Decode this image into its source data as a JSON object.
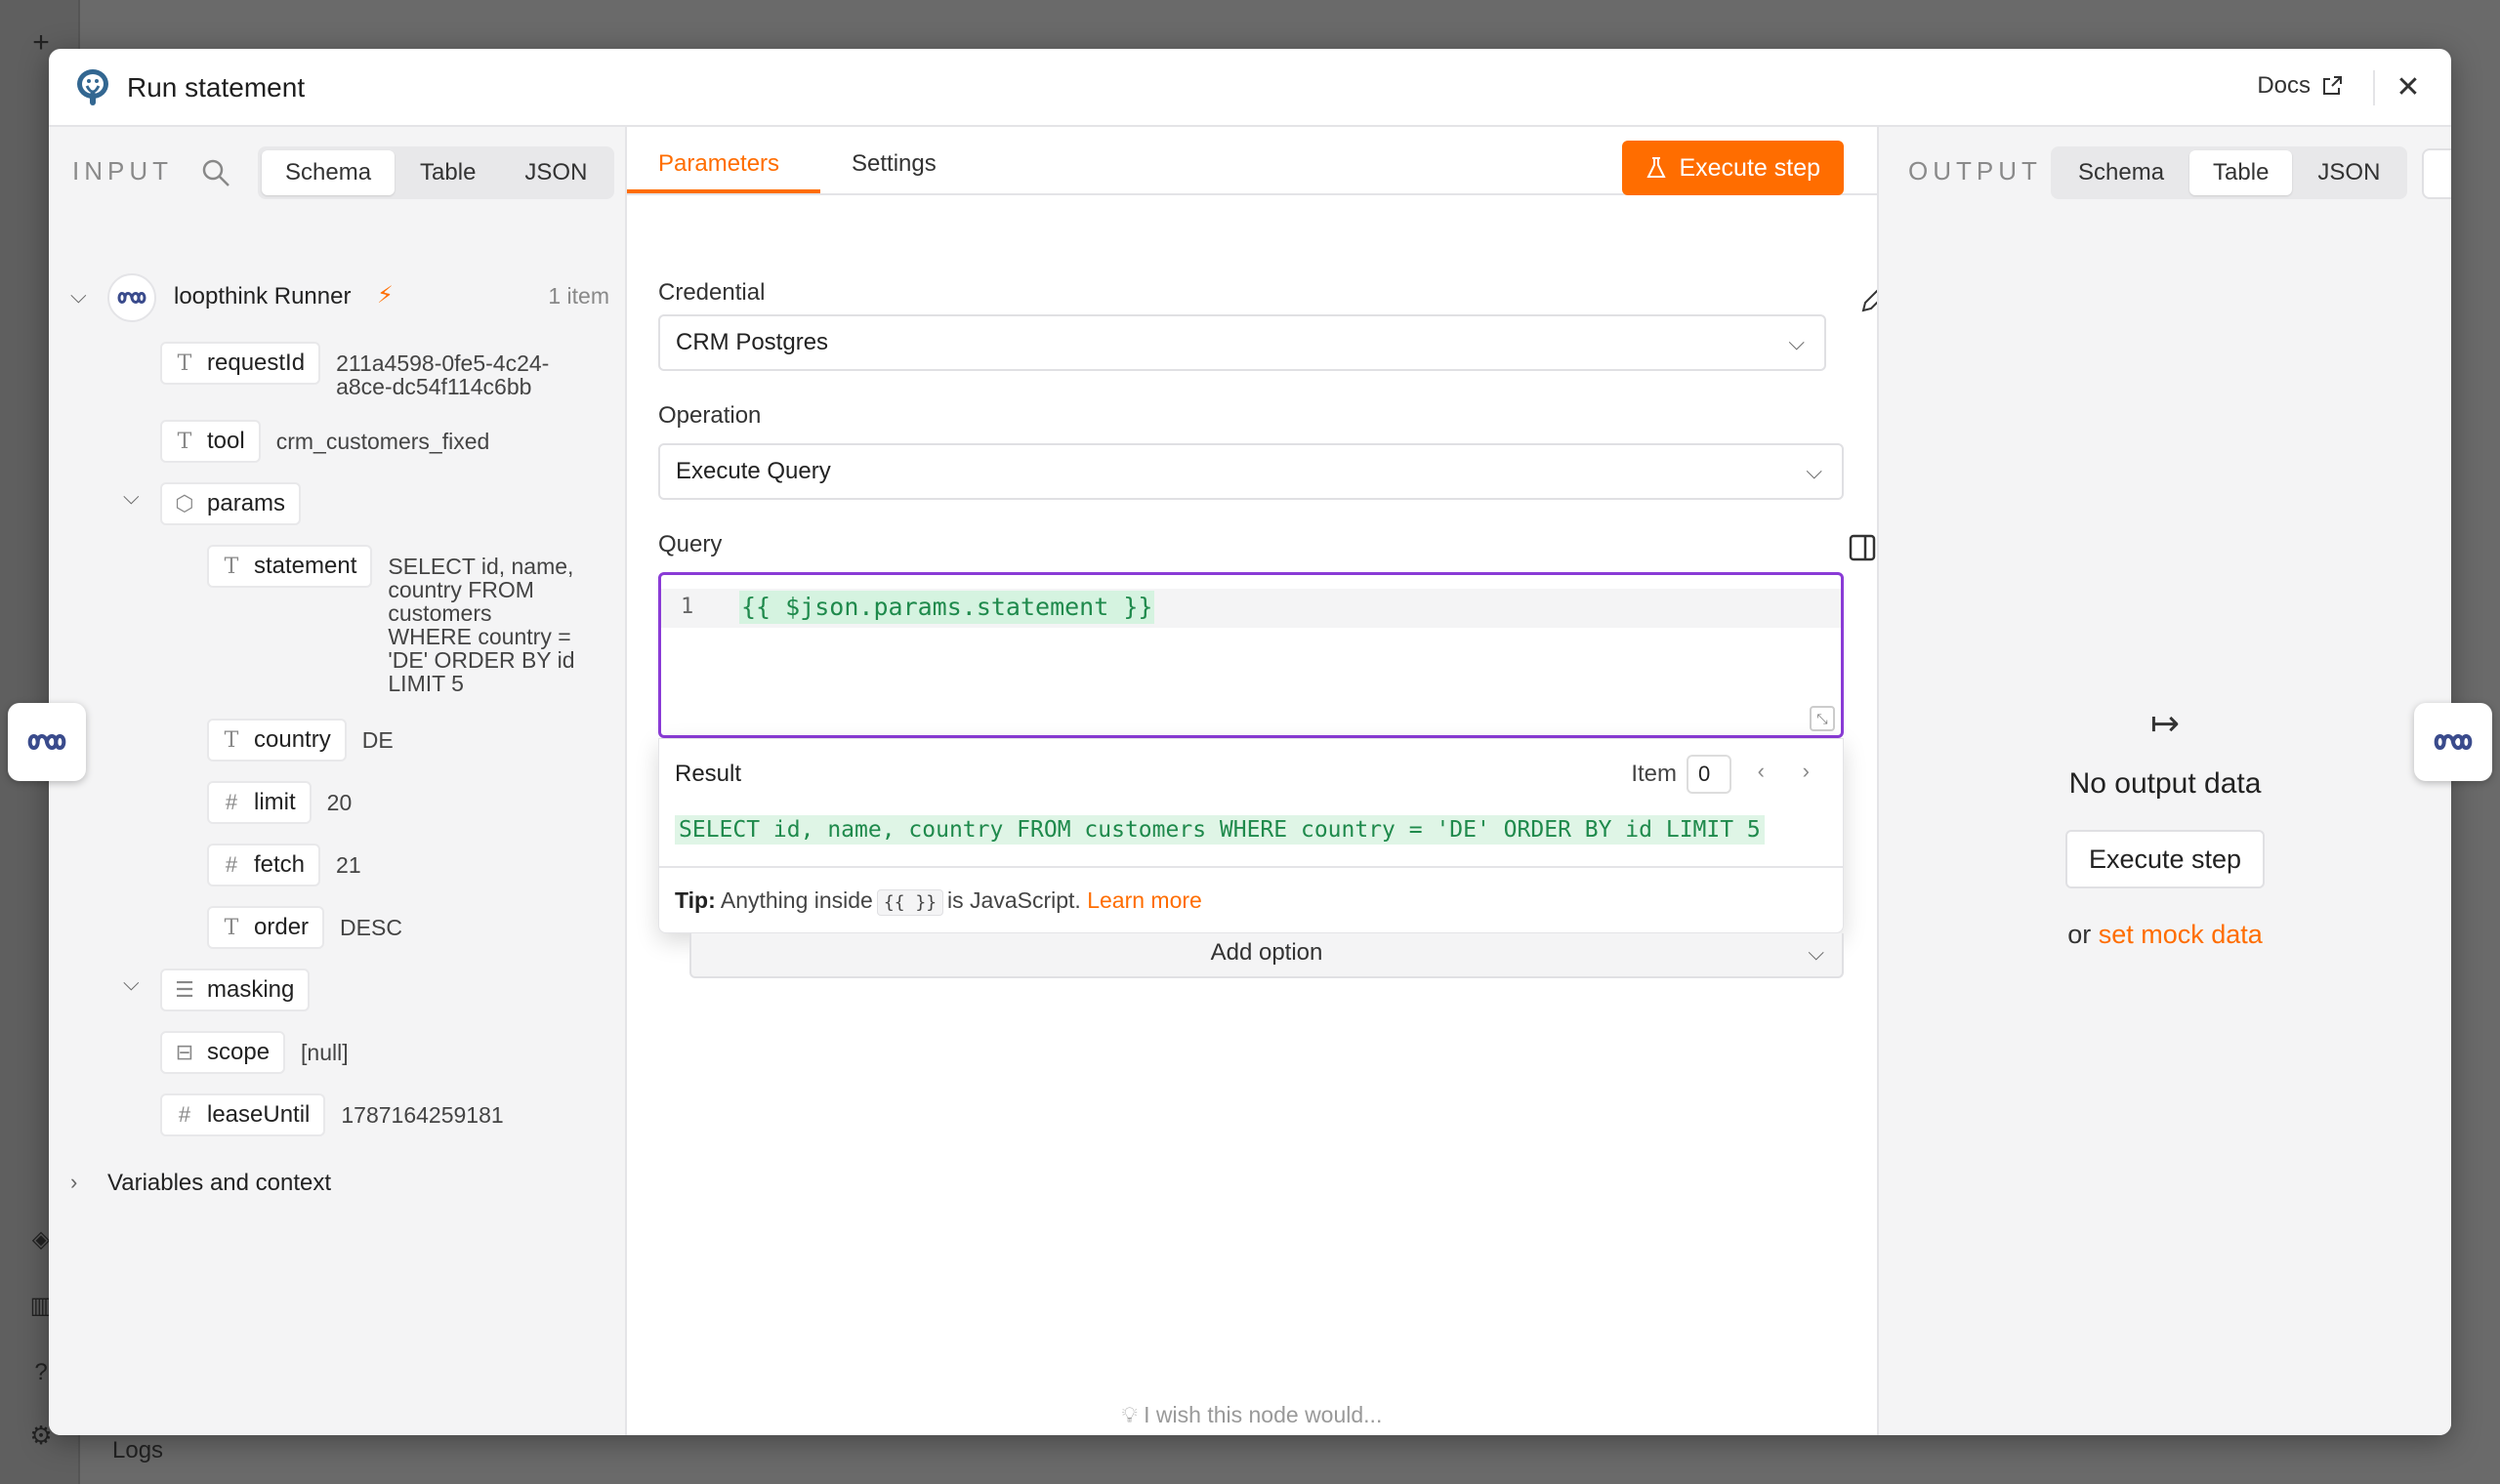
{
  "modal": {
    "title": "Run statement",
    "docs_label": "Docs"
  },
  "input_panel": {
    "title": "INPUT",
    "tabs": [
      "Schema",
      "Table",
      "JSON"
    ],
    "active_tab": "Schema",
    "source": {
      "name": "loopthink Runner",
      "count": "1 item"
    },
    "fields": {
      "requestId": {
        "key": "requestId",
        "value_line1": "211a4598-0fe5-4c24-",
        "value_line2": "a8ce-dc54f114c6bb"
      },
      "tool": {
        "key": "tool",
        "value": "crm_customers_fixed"
      },
      "params": {
        "key": "params"
      },
      "statement": {
        "key": "statement",
        "lines": [
          "SELECT id, name,",
          "country FROM",
          "customers",
          "WHERE country =",
          "'DE' ORDER BY id",
          "LIMIT 5"
        ]
      },
      "country": {
        "key": "country",
        "value": "DE"
      },
      "limit": {
        "key": "limit",
        "value": "20"
      },
      "fetch": {
        "key": "fetch",
        "value": "21"
      },
      "order": {
        "key": "order",
        "value": "DESC"
      },
      "masking": {
        "key": "masking"
      },
      "scope": {
        "key": "scope",
        "value": "[null]"
      },
      "leaseUntil": {
        "key": "leaseUntil",
        "value": "1787164259181"
      }
    },
    "variables_label": "Variables and context"
  },
  "params_panel": {
    "tabs": [
      "Parameters",
      "Settings"
    ],
    "active_tab": "Parameters",
    "execute_label": "Execute step",
    "credential_label": "Credential",
    "credential_value": "CRM Postgres",
    "operation_label": "Operation",
    "operation_value": "Execute Query",
    "query_label": "Query",
    "query_line_number": "1",
    "query_expression": "{{ $json.params.statement }}",
    "result_label": "Result",
    "item_label": "Item",
    "item_value": "0",
    "result_value": "SELECT id, name, country FROM customers WHERE country = 'DE' ORDER BY id LIMIT 5",
    "tip_prefix": "Tip:",
    "tip_text_1": "Anything inside",
    "tip_code": "{{ }}",
    "tip_text_2": "is JavaScript.",
    "tip_link": "Learn more",
    "add_option_label": "Add option",
    "wish_label": "I wish this node would..."
  },
  "output_panel": {
    "title": "OUTPUT",
    "tabs": [
      "Schema",
      "Table",
      "JSON"
    ],
    "active_tab": "Table",
    "empty_title": "No output data",
    "execute_label": "Execute step",
    "mock_prefix": "or",
    "mock_link": "set mock data"
  },
  "background": {
    "logs_label": "Logs"
  },
  "colors": {
    "accent": "#ff6d00",
    "editor_border": "#8a3bd6",
    "expression_green": "#1f8a4c"
  }
}
